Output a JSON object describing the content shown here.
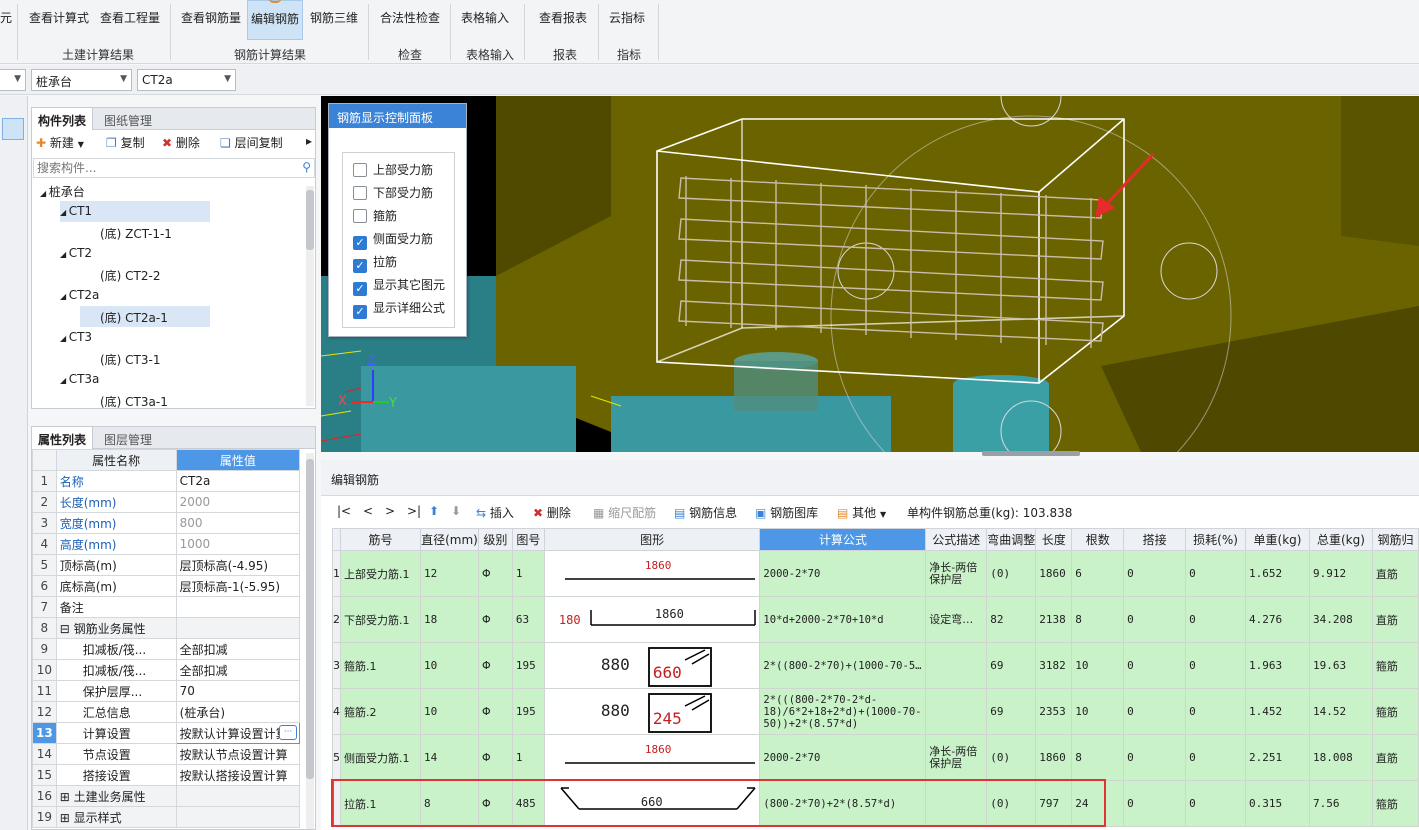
{
  "ribbon": {
    "buttons": [
      {
        "label": "元"
      },
      {
        "label": "查看计算式"
      },
      {
        "label": "查看工程量"
      },
      {
        "label": "查看钢筋量"
      },
      {
        "label": "编辑钢筋"
      },
      {
        "label": "钢筋三维"
      },
      {
        "label": "合法性检查"
      },
      {
        "label": "表格输入"
      },
      {
        "label": "查看报表"
      },
      {
        "label": "云指标"
      }
    ],
    "groups": [
      "土建计算结果",
      "钢筋计算结果",
      "检查",
      "表格输入",
      "报表",
      "指标"
    ]
  },
  "selectors": {
    "combo1": "",
    "combo2": "桩承台",
    "combo3": "CT2a"
  },
  "component_panel": {
    "tabs": [
      "构件列表",
      "图纸管理"
    ],
    "toolbar": {
      "new": "新建",
      "copy": "复制",
      "delete": "删除",
      "floor_copy": "层间复制"
    },
    "search_placeholder": "搜索构件...",
    "tree": [
      {
        "label": "桩承台",
        "level": 0
      },
      {
        "label": "CT1",
        "level": 1
      },
      {
        "label": "(底) ZCT-1-1",
        "level": 2
      },
      {
        "label": "CT2",
        "level": 1
      },
      {
        "label": "(底) CT2-2",
        "level": 2
      },
      {
        "label": "CT2a",
        "level": 1
      },
      {
        "label": "(底) CT2a-1",
        "level": 2
      },
      {
        "label": "CT3",
        "level": 1
      },
      {
        "label": "(底) CT3-1",
        "level": 2
      },
      {
        "label": "CT3a",
        "level": 1
      },
      {
        "label": "(底) CT3a-1",
        "level": 2
      }
    ]
  },
  "property_panel": {
    "tabs": [
      "属性列表",
      "图层管理"
    ],
    "header": {
      "name": "属性名称",
      "value": "属性值"
    },
    "rows": [
      {
        "n": "1",
        "name": "名称",
        "value": "CT2a"
      },
      {
        "n": "2",
        "name": "长度(mm)",
        "value": "2000"
      },
      {
        "n": "3",
        "name": "宽度(mm)",
        "value": "800"
      },
      {
        "n": "4",
        "name": "高度(mm)",
        "value": "1000"
      },
      {
        "n": "5",
        "name": "顶标高(m)",
        "value": "层顶标高(-4.95)"
      },
      {
        "n": "6",
        "name": "底标高(m)",
        "value": "层顶标高-1(-5.95)"
      },
      {
        "n": "7",
        "name": "备注",
        "value": ""
      },
      {
        "n": "8",
        "name": "⊟ 钢筋业务属性",
        "value": ""
      },
      {
        "n": "9",
        "name": "扣减板/筏...",
        "value": "全部扣减"
      },
      {
        "n": "10",
        "name": "扣减板/筏...",
        "value": "全部扣减"
      },
      {
        "n": "11",
        "name": "保护层厚...",
        "value": "70"
      },
      {
        "n": "12",
        "name": "汇总信息",
        "value": "(桩承台)"
      },
      {
        "n": "13",
        "name": "计算设置",
        "value": "按默认计算设置计算"
      },
      {
        "n": "14",
        "name": "节点设置",
        "value": "按默认节点设置计算"
      },
      {
        "n": "15",
        "name": "搭接设置",
        "value": "按默认搭接设置计算"
      },
      {
        "n": "16",
        "name": "⊞ 土建业务属性",
        "value": ""
      },
      {
        "n": "19",
        "name": "⊞ 显示样式",
        "value": ""
      }
    ]
  },
  "control_panel": {
    "title": "钢筋显示控制面板",
    "items": [
      {
        "label": "上部受力筋",
        "checked": false
      },
      {
        "label": "下部受力筋",
        "checked": false
      },
      {
        "label": "箍筋",
        "checked": false
      },
      {
        "label": "侧面受力筋",
        "checked": true
      },
      {
        "label": "拉筋",
        "checked": true
      },
      {
        "label": "显示其它图元",
        "checked": true
      },
      {
        "label": "显示详细公式",
        "checked": true
      }
    ]
  },
  "axis_labels": {
    "z": "Z",
    "x": "X",
    "y": "Y"
  },
  "editor": {
    "title": "编辑钢筋",
    "nav": [
      "|<",
      "<",
      ">",
      ">|"
    ],
    "tools": {
      "insert": "插入",
      "delete": "删除",
      "scale": "缩尺配筋",
      "info": "钢筋信息",
      "library": "钢筋图库",
      "other": "其他"
    },
    "total_label": "单构件钢筋总重(kg): 103.838",
    "columns": [
      "筋号",
      "直径(mm)",
      "级别",
      "图号",
      "图形",
      "计算公式",
      "公式描述",
      "弯曲调整",
      "长度",
      "根数",
      "搭接",
      "损耗(%)",
      "单重(kg)",
      "总重(kg)",
      "钢筋归"
    ],
    "rows": [
      {
        "idx": "1",
        "name": "上部受力筋.1",
        "dia": "12",
        "grade": "Φ",
        "fig": "1",
        "shape": {
          "type": "line",
          "main": "1860"
        },
        "formula": "2000-2*70",
        "desc": "净长-两倍保护层",
        "bend": "(0)",
        "len": "1860",
        "count": "6",
        "lap": "0",
        "loss": "0",
        "unit": "1.652",
        "total": "9.912",
        "cat": "直筋"
      },
      {
        "idx": "2",
        "name": "下部受力筋.1",
        "dia": "18",
        "grade": "Φ",
        "fig": "63",
        "shape": {
          "type": "hook",
          "main": "1860",
          "left": "180"
        },
        "formula": "10*d+2000-2*70+10*d",
        "desc": "设定弯…",
        "bend": "82",
        "len": "2138",
        "count": "8",
        "lap": "0",
        "loss": "0",
        "unit": "4.276",
        "total": "34.208",
        "cat": "直筋"
      },
      {
        "idx": "3",
        "name": "箍筋.1",
        "dia": "10",
        "grade": "Φ",
        "fig": "195",
        "shape": {
          "type": "stirrup",
          "main": "880",
          "inner": "660"
        },
        "formula": "2*((800-2*70)+(1000-70-5…",
        "desc": "",
        "bend": "69",
        "len": "3182",
        "count": "10",
        "lap": "0",
        "loss": "0",
        "unit": "1.963",
        "total": "19.63",
        "cat": "箍筋"
      },
      {
        "idx": "4",
        "name": "箍筋.2",
        "dia": "10",
        "grade": "Φ",
        "fig": "195",
        "shape": {
          "type": "stirrup",
          "main": "880",
          "inner": "245"
        },
        "formula": "2*(((800-2*70-2*d-18)/6*2+18+2*d)+(1000-70-50))+2*(8.57*d)",
        "desc": "",
        "bend": "69",
        "len": "2353",
        "count": "10",
        "lap": "0",
        "loss": "0",
        "unit": "1.452",
        "total": "14.52",
        "cat": "箍筋"
      },
      {
        "idx": "5",
        "name": "侧面受力筋.1",
        "dia": "14",
        "grade": "Φ",
        "fig": "1",
        "shape": {
          "type": "line",
          "main": "1860"
        },
        "formula": "2000-2*70",
        "desc": "净长-两倍保护层",
        "bend": "(0)",
        "len": "1860",
        "count": "8",
        "lap": "0",
        "loss": "0",
        "unit": "2.251",
        "total": "18.008",
        "cat": "直筋"
      },
      {
        "idx": "",
        "name": "拉筋.1",
        "dia": "8",
        "grade": "Φ",
        "fig": "485",
        "shape": {
          "type": "tie",
          "main": "660"
        },
        "formula": "(800-2*70)+2*(8.57*d)",
        "desc": "",
        "bend": "(0)",
        "len": "797",
        "count": "24",
        "lap": "0",
        "loss": "0",
        "unit": "0.315",
        "total": "7.56",
        "cat": "箍筋"
      }
    ]
  },
  "colors": {
    "accent": "#3b83d6",
    "highlight_border": "#e03434",
    "row_green": "#c9f2c9",
    "scene_olive": "#6b6300"
  }
}
